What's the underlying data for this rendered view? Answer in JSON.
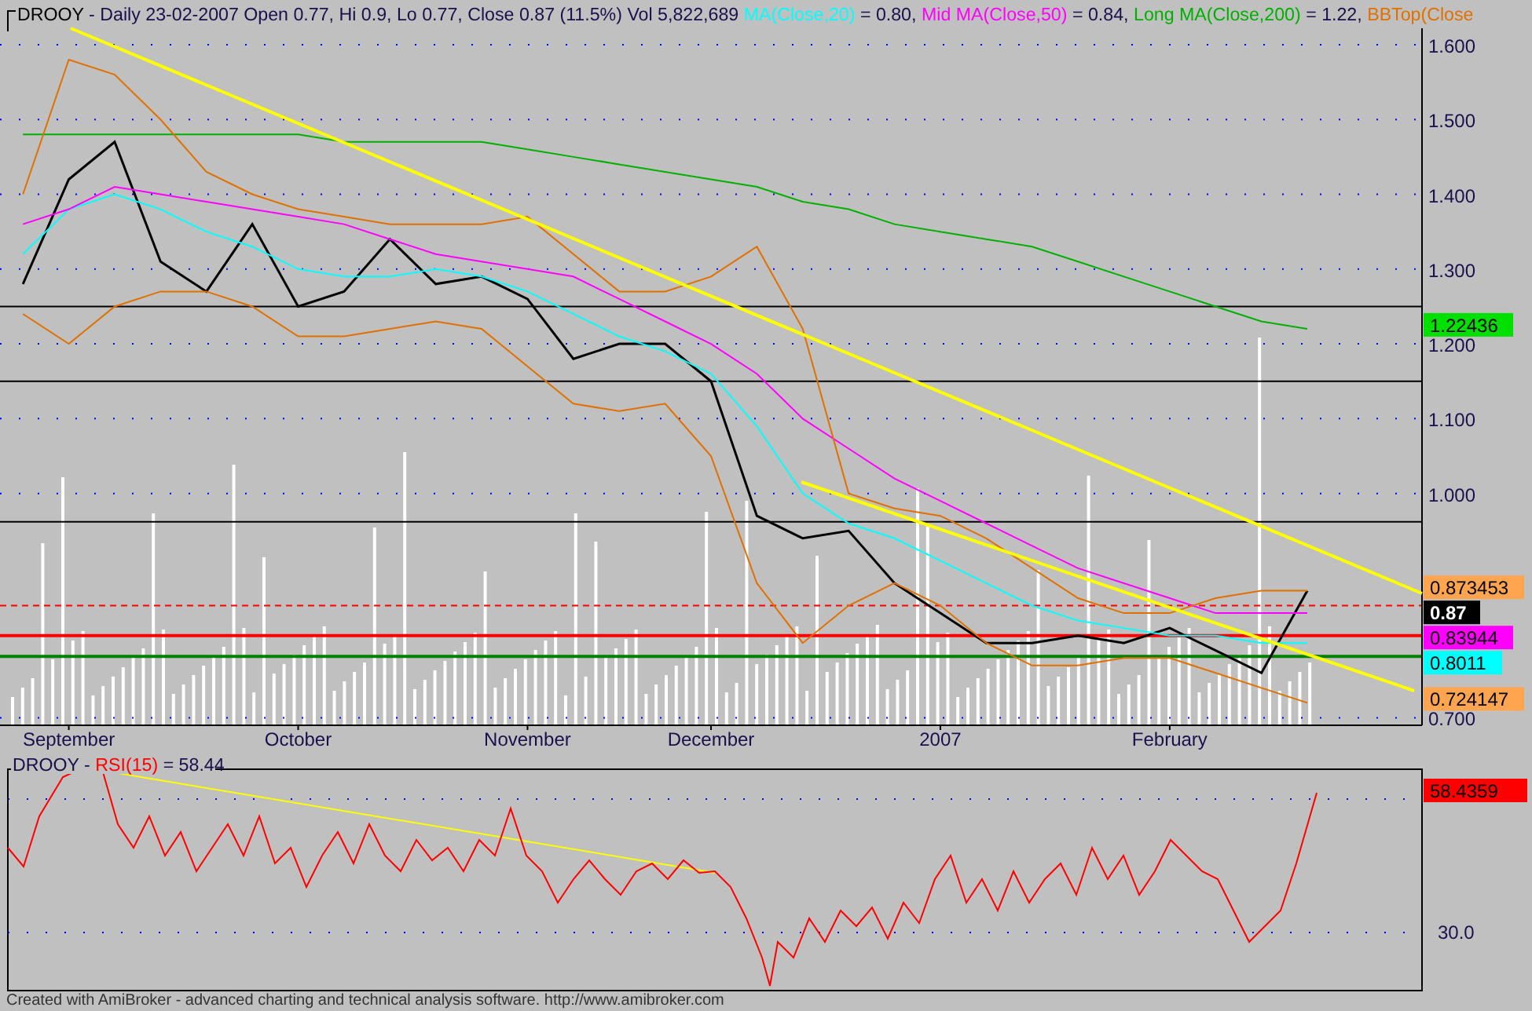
{
  "header": {
    "title": "- Daily 23-02-2007 Open 0.77, Hi 0.9, Lo 0.77, Close 0.87 (11.5%) Vol 5,822,689",
    "readings": [
      "= 0.80,",
      "= 0.84,",
      "= 1.22,"
    ]
  },
  "price_chart": {
    "chart_data": {
      "type": "line",
      "grid": true,
      "categories": [
        null,
        "September",
        null,
        null,
        null,
        null,
        "October",
        null,
        null,
        null,
        null,
        "November",
        null,
        null,
        null,
        "December",
        null,
        null,
        null,
        null,
        "2007",
        null,
        null,
        null,
        null,
        "February",
        null,
        null,
        null,
        null,
        null
      ],
      "ylim": [
        0.69,
        1.622
      ],
      "yticks": [
        {
          "value": 1.6,
          "label": "1.600"
        },
        {
          "value": 1.5,
          "label": "1.500"
        },
        {
          "value": 1.4,
          "label": "1.400"
        },
        {
          "value": 1.3,
          "label": "1.300"
        },
        {
          "value": 1.2,
          "label": "1.200"
        },
        {
          "value": 1.1,
          "label": "1.100"
        },
        {
          "value": 1.0,
          "label": "1.000"
        },
        {
          "value": 0.7,
          "label": "0.700"
        }
      ],
      "series": [
        {
          "name": "DROOY",
          "color": "#000000",
          "values": [
            1.28,
            1.42,
            1.47,
            1.31,
            1.27,
            1.36,
            1.25,
            1.27,
            1.34,
            1.28,
            1.29,
            1.26,
            1.18,
            1.2,
            1.2,
            1.15,
            0.97,
            0.94,
            0.95,
            0.88,
            0.84,
            0.8,
            0.8,
            0.81,
            0.8,
            0.82,
            0.79,
            0.76,
            0.87,
            null,
            null
          ]
        },
        {
          "name": "MA(Close,20)",
          "color": "#00ffff",
          "values": [
            1.32,
            1.38,
            1.4,
            1.38,
            1.35,
            1.33,
            1.3,
            1.29,
            1.29,
            1.3,
            1.29,
            1.27,
            1.24,
            1.21,
            1.19,
            1.16,
            1.09,
            1.0,
            0.96,
            0.94,
            0.91,
            0.88,
            0.85,
            0.83,
            0.82,
            0.81,
            0.81,
            0.8,
            0.8,
            null,
            null
          ]
        },
        {
          "name": "Mid MA(Close,50)",
          "color": "#ff00ff",
          "values": [
            1.36,
            1.38,
            1.41,
            1.4,
            1.39,
            1.38,
            1.37,
            1.36,
            1.34,
            1.32,
            1.31,
            1.3,
            1.29,
            1.26,
            1.23,
            1.2,
            1.16,
            1.1,
            1.06,
            1.02,
            0.99,
            0.96,
            0.93,
            0.9,
            0.88,
            0.86,
            0.84,
            0.84,
            0.84,
            null,
            null
          ]
        },
        {
          "name": "Long MA(Close,200)",
          "color": "#00b000",
          "values": [
            1.48,
            1.48,
            1.48,
            1.48,
            1.48,
            1.48,
            1.48,
            1.47,
            1.47,
            1.47,
            1.47,
            1.46,
            1.45,
            1.44,
            1.43,
            1.42,
            1.41,
            1.39,
            1.38,
            1.36,
            1.35,
            1.34,
            1.33,
            1.31,
            1.29,
            1.27,
            1.25,
            1.23,
            1.22,
            null,
            null
          ]
        },
        {
          "name": "BBTop(Close",
          "color": "#e07000",
          "values": [
            1.4,
            1.58,
            1.56,
            1.5,
            1.43,
            1.4,
            1.38,
            1.37,
            1.36,
            1.36,
            1.36,
            1.37,
            1.32,
            1.27,
            1.27,
            1.29,
            1.33,
            1.22,
            1.0,
            0.98,
            0.97,
            0.94,
            0.9,
            0.86,
            0.84,
            0.84,
            0.86,
            0.87,
            0.87,
            null,
            null
          ]
        },
        {
          "color": "#e07000",
          "values": [
            1.24,
            1.2,
            1.25,
            1.27,
            1.27,
            1.25,
            1.21,
            1.21,
            1.22,
            1.23,
            1.22,
            1.17,
            1.12,
            1.11,
            1.12,
            1.05,
            0.88,
            0.8,
            0.85,
            0.88,
            0.85,
            0.8,
            0.77,
            0.77,
            0.78,
            0.78,
            0.76,
            0.74,
            0.72,
            null,
            null
          ]
        }
      ]
    }
  },
  "axis_chips": [
    {
      "text": "1.22436",
      "color": "#00e000"
    },
    {
      "text": "0.873453",
      "color": "#ffa54f"
    },
    {
      "text": "0.87",
      "color": "#000000"
    },
    {
      "text": "0.83944",
      "color": "#ff00ff"
    },
    {
      "text": "0.8011",
      "color": "#00ffff"
    },
    {
      "text": "0.724147",
      "color": "#ffa54f"
    }
  ],
  "rsi_pane": {
    "ticker": "DROOY -",
    "indicator": {
      "name": "RSI(15)",
      "color": "#ff0000"
    },
    "reading": "= 58.44",
    "axis_label": "30.0",
    "chip": {
      "text": "58.4359",
      "color": "#ff0000"
    }
  },
  "footer": "Created with AmiBroker - advanced charting and technical analysis software. http://www.amibroker.com"
}
